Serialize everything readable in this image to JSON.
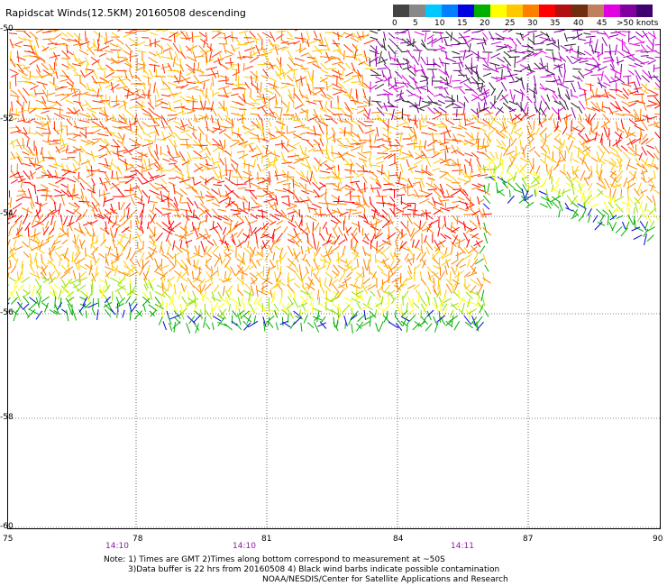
{
  "title": "Rapidscat Winds(12.5KM) 20160508 descending",
  "colorbar": {
    "labels": [
      "0",
      "5",
      "10",
      "15",
      "20",
      "25",
      "30",
      "35",
      "40",
      "45",
      ">50 knots"
    ],
    "colors": [
      "#444444",
      "#888888",
      "#00c8ff",
      "#0080ff",
      "#0000e0",
      "#00b000",
      "#ffff00",
      "#ffc800",
      "#ff8000",
      "#ff0000",
      "#b01010",
      "#703010",
      "#c08060",
      "#e000e0",
      "#8000a0",
      "#400070"
    ]
  },
  "lat_labels": [
    "-50",
    "-52",
    "-54",
    "-56",
    "-58",
    "-60"
  ],
  "lon_labels": [
    "75",
    "78",
    "81",
    "84",
    "87",
    "90"
  ],
  "time_labels": [
    "14:10",
    "14:10",
    "14:11"
  ],
  "notes": [
    "Note: 1) Times are GMT 2)Times along bottom correspond to measurement at ~50S",
    "3)Data buffer is 22 hrs from 20160508 4) Black wind barbs indicate possible contamination",
    "NOAA/NESDIS/Center for Satellite Applications and Research"
  ]
}
